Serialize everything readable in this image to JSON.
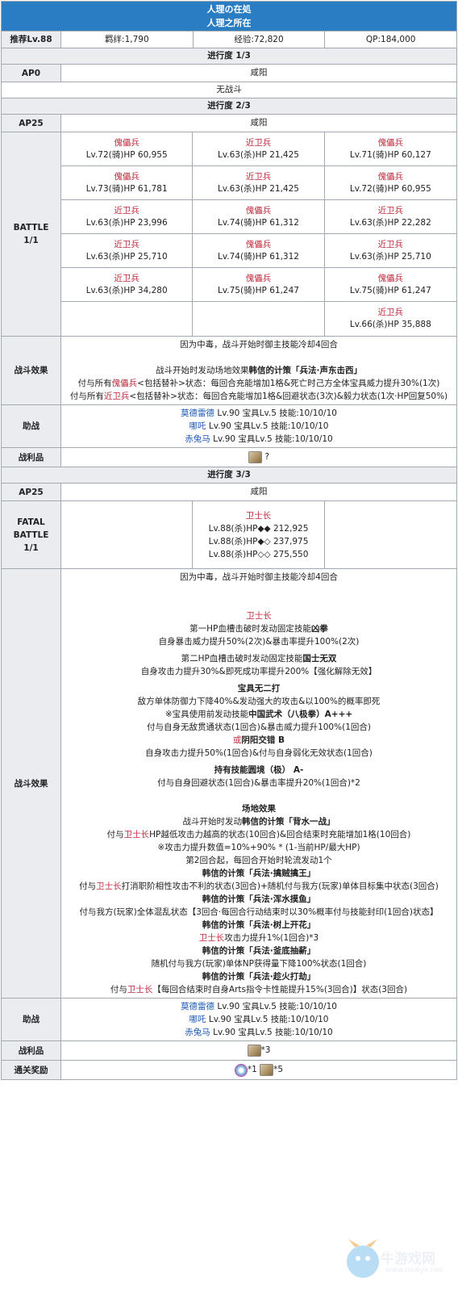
{
  "title": {
    "line1": "人理の在処",
    "line2": "人理之所在"
  },
  "rec": {
    "label": "推荐Lv.88",
    "bond": "羁绊:1,790",
    "exp": "经验:72,820",
    "qp": "QP:184,000"
  },
  "p1": {
    "title": "进行度 1/3",
    "ap": "AP0",
    "place": "咸阳",
    "note": "无战斗"
  },
  "p2": {
    "title": "进行度 2/3",
    "ap": "AP25",
    "place": "咸阳",
    "battle": "BATTLE\n1/1",
    "enemies": [
      [
        "傀儡兵",
        "Lv.72(骑)HP 60,955"
      ],
      [
        "近卫兵",
        "Lv.63(杀)HP 21,425"
      ],
      [
        "傀儡兵",
        "Lv.71(骑)HP 60,127"
      ],
      [
        "傀儡兵",
        "Lv.73(骑)HP 61,781"
      ],
      [
        "近卫兵",
        "Lv.63(杀)HP 21,425"
      ],
      [
        "傀儡兵",
        "Lv.72(骑)HP 60,955"
      ],
      [
        "近卫兵",
        "Lv.63(杀)HP 23,996"
      ],
      [
        "傀儡兵",
        "Lv.74(骑)HP 61,312"
      ],
      [
        "近卫兵",
        "Lv.63(杀)HP 22,282"
      ],
      [
        "近卫兵",
        "Lv.63(杀)HP 25,710"
      ],
      [
        "傀儡兵",
        "Lv.74(骑)HP 61,312"
      ],
      [
        "近卫兵",
        "Lv.63(杀)HP 25,710"
      ],
      [
        "近卫兵",
        "Lv.63(杀)HP 34,280"
      ],
      [
        "傀儡兵",
        "Lv.75(骑)HP 61,247"
      ],
      [
        "傀儡兵",
        "Lv.75(骑)HP 61,247"
      ],
      [
        "",
        ""
      ],
      [
        "",
        ""
      ],
      [
        "近卫兵",
        "Lv.66(杀)HP 35,888"
      ]
    ],
    "effect_label": "战斗效果",
    "eff1": "因为中毒，战斗开始时御主技能冷却4回合",
    "eff2a": "战斗开始时发动场地效果",
    "eff2b": "韩信的计策「兵法·声东击西」",
    "eff3a": "付与所有",
    "eff3n": "傀儡兵",
    "eff3b": "<包括替补>状态：每回合充能增加1格&死亡时己方全体宝具威力提升30%(1次)",
    "eff4a": "付与所有",
    "eff4n": "近卫兵",
    "eff4b": "<包括替补>状态：每回合充能增加1格&回避状态(3次)&毅力状态(1次·HP回复50%)",
    "support_label": "助战",
    "support": [
      [
        "莫德雷德",
        " Lv.90 宝具Lv.5 技能:10/10/10"
      ],
      [
        "哪吒",
        " Lv.90 宝具Lv.5 技能:10/10/10"
      ],
      [
        "赤兔马",
        " Lv.90 宝具Lv.5 技能:10/10/10"
      ]
    ],
    "loot_label": "战利品",
    "loot": "?"
  },
  "p3": {
    "title": "进行度 3/3",
    "ap": "AP25",
    "place": "咸阳",
    "battle": "FATAL\nBATTLE\n1/1",
    "boss": "卫士长",
    "hp": [
      "Lv.88(杀)HP◆◆ 212,925",
      "Lv.88(杀)HP◆◇ 237,975",
      "Lv.88(杀)HP◇◇ 275,550"
    ],
    "effect_label": "战斗效果",
    "lines": {
      "l1": "因为中毒，战斗开始时御主技能冷却4回合",
      "boss": "卫士长",
      "g1h": "第一HP血槽击破时发动固定技能",
      "g1n": "凶拳",
      "g1d": "自身暴击威力提升50%(2次)&暴击率提升100%(2次)",
      "g2h": "第二HP血槽击破时发动固定技能",
      "g2n": "国士无双",
      "g2d": "自身攻击力提升30%&即死成功率提升200%【强化解除无效】",
      "np": "宝具无二打",
      "np1": "敌方单体防御力下降40%&发动强大的攻击&以100%的概率即死",
      "np2a": "※宝具使用前发动技能",
      "np2b": "中国武术（八极拳）A+++",
      "np3": "付与自身无敌贯通状态(1回合)&暴击威力提升100%(1回合)",
      "or": "或",
      "yy": "阴阳交错 B",
      "yyd": "自身攻击力提升50%(1回合)&付与自身弱化无效状态(1回合)",
      "ps1": "持有技能",
      "ps2": "圆境（极） A-",
      "psd": "付与自身回避状态(1回合)&暴击率提升20%(1回合)*2",
      "fe": "场地效果",
      "fe1a": "战斗开始时发动",
      "fe1b": "韩信的计策「背水一战」",
      "fe2a": "付与",
      "fe2n": "卫士长",
      "fe2b": "HP越低攻击力越高的状态(10回合)&回合结束时充能增加1格(10回合)",
      "fe3": "※攻击力提升数值=10%+90% * (1-当前HP/最大HP)",
      "fe4": "第2回合起，每回合开始时轮流发动1个",
      "c1": "韩信的计策「兵法·擒贼擒王」",
      "c1a": "付与",
      "c1n": "卫士长",
      "c1b": "打消职阶相性攻击不利的状态(3回合)+随机付与我方(玩家)单体目标集中状态(3回合)",
      "c2": "韩信的计策「兵法·浑水摸鱼」",
      "c2d": "付与我方(玩家)全体混乱状态【3回合·每回合行动结束时以30%概率付与技能封印(1回合)状态】",
      "c3": "韩信的计策「兵法·树上开花」",
      "c3n": "卫士长",
      "c3b": "攻击力提升1%(1回合)*3",
      "c4": "韩信的计策「兵法·釜底抽薪」",
      "c4d": "随机付与我方(玩家)单体NP获得量下降100%状态(1回合)",
      "c5": "韩信的计策「兵法·趁火打劫」",
      "c5a": "付与",
      "c5n": "卫士长",
      "c5b": "【每回合结束时自身Arts指令卡性能提升15%(3回合)】状态(3回合)"
    },
    "support_label": "助战",
    "support": [
      [
        "莫德雷德",
        " Lv.90 宝具Lv.5 技能:10/10/10"
      ],
      [
        "哪吒",
        " Lv.90 宝具Lv.5 技能:10/10/10"
      ],
      [
        "赤兔马",
        " Lv.90 宝具Lv.5 技能:10/10/10"
      ]
    ],
    "loot_label": "战利品",
    "loot": "*3",
    "reward_label": "通关奖励",
    "reward1": "*1",
    "reward2": "*5"
  },
  "watermark": {
    "name": "牛游戏网",
    "url": "www.newyx.net"
  }
}
